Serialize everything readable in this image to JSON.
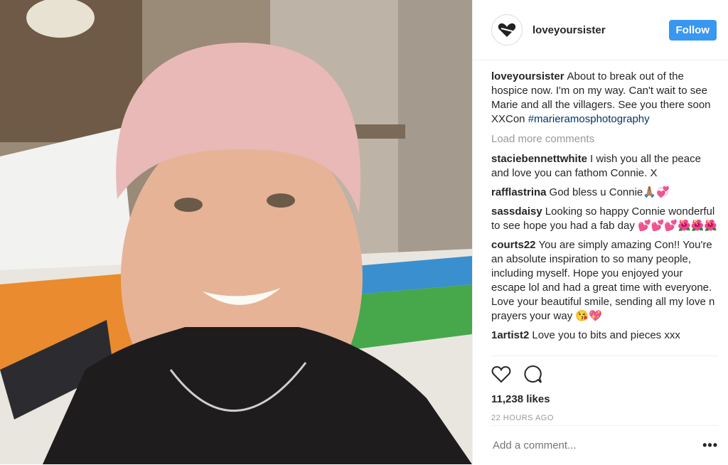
{
  "post": {
    "username": "loveyoursister",
    "follow_label": "Follow",
    "caption": {
      "author": "loveyoursister",
      "text": "About to break out of the hospice now. I'm on my way. Can't wait to see Marie and all the villagers. See you there soon XXCon",
      "hashtag": "#marieramosphotography"
    },
    "load_more_label": "Load more comments",
    "comments": [
      {
        "author": "staciebennettwhite",
        "text": "I wish you all the peace and love you can fathom Connie. X"
      },
      {
        "author": "rafflastrina",
        "text": "God bless u Connie🙏🏽💞"
      },
      {
        "author": "sassdaisy",
        "text": "Looking so happy Connie wonderful to see hope you had a fab day 💕💕💕🌺🌺🌺"
      },
      {
        "author": "courts22",
        "text": "You are simply amazing Con!! You're an absolute inspiration to so many people, including myself. Hope you enjoyed your escape lol and had a great time with everyone. Love your beautiful smile, sending all my love n prayers your way 😘💖"
      },
      {
        "author": "1artist2",
        "text": "Love you to bits and pieces xxx"
      }
    ],
    "likes": "11,238 likes",
    "timestamp": "22 HOURS AGO",
    "add_comment_placeholder": "Add a comment...",
    "more_options": "•••"
  },
  "icons": {
    "avatar": "heart-logo-icon",
    "like": "heart-icon",
    "comment": "comment-icon"
  },
  "colors": {
    "follow_bg": "#3897f0",
    "hashtag": "#003569",
    "muted": "#999999"
  }
}
